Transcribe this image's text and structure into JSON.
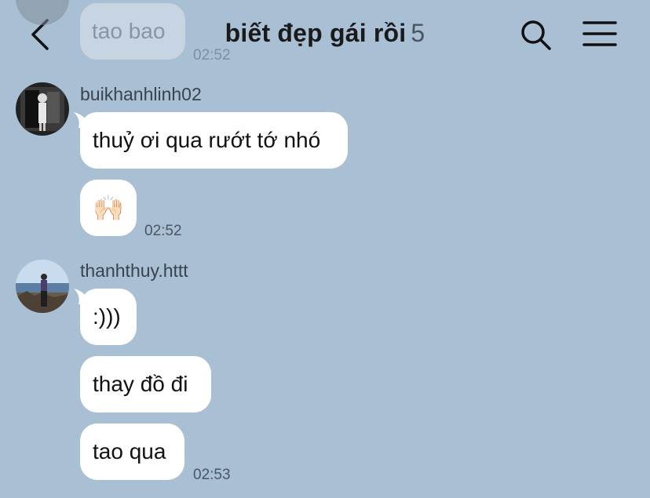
{
  "header": {
    "title": "biết đẹp gái rồi",
    "member_count": "5",
    "back_icon": "chevron-left-icon",
    "search_icon": "search-icon",
    "menu_icon": "hamburger-menu-icon"
  },
  "previous": {
    "text": "tao bao",
    "time": "02:52"
  },
  "groups": [
    {
      "sender": "buikhanhlinh02",
      "messages": [
        {
          "text": "thuỷ ơi qua rướt tớ nhó"
        },
        {
          "text": "🙌🏻"
        }
      ],
      "time": "02:52"
    },
    {
      "sender": "thanhthuy.httt",
      "messages": [
        {
          "text": ":)))"
        },
        {
          "text": "thay đồ đi"
        },
        {
          "text": "tao qua"
        }
      ],
      "time": "02:53"
    }
  ]
}
